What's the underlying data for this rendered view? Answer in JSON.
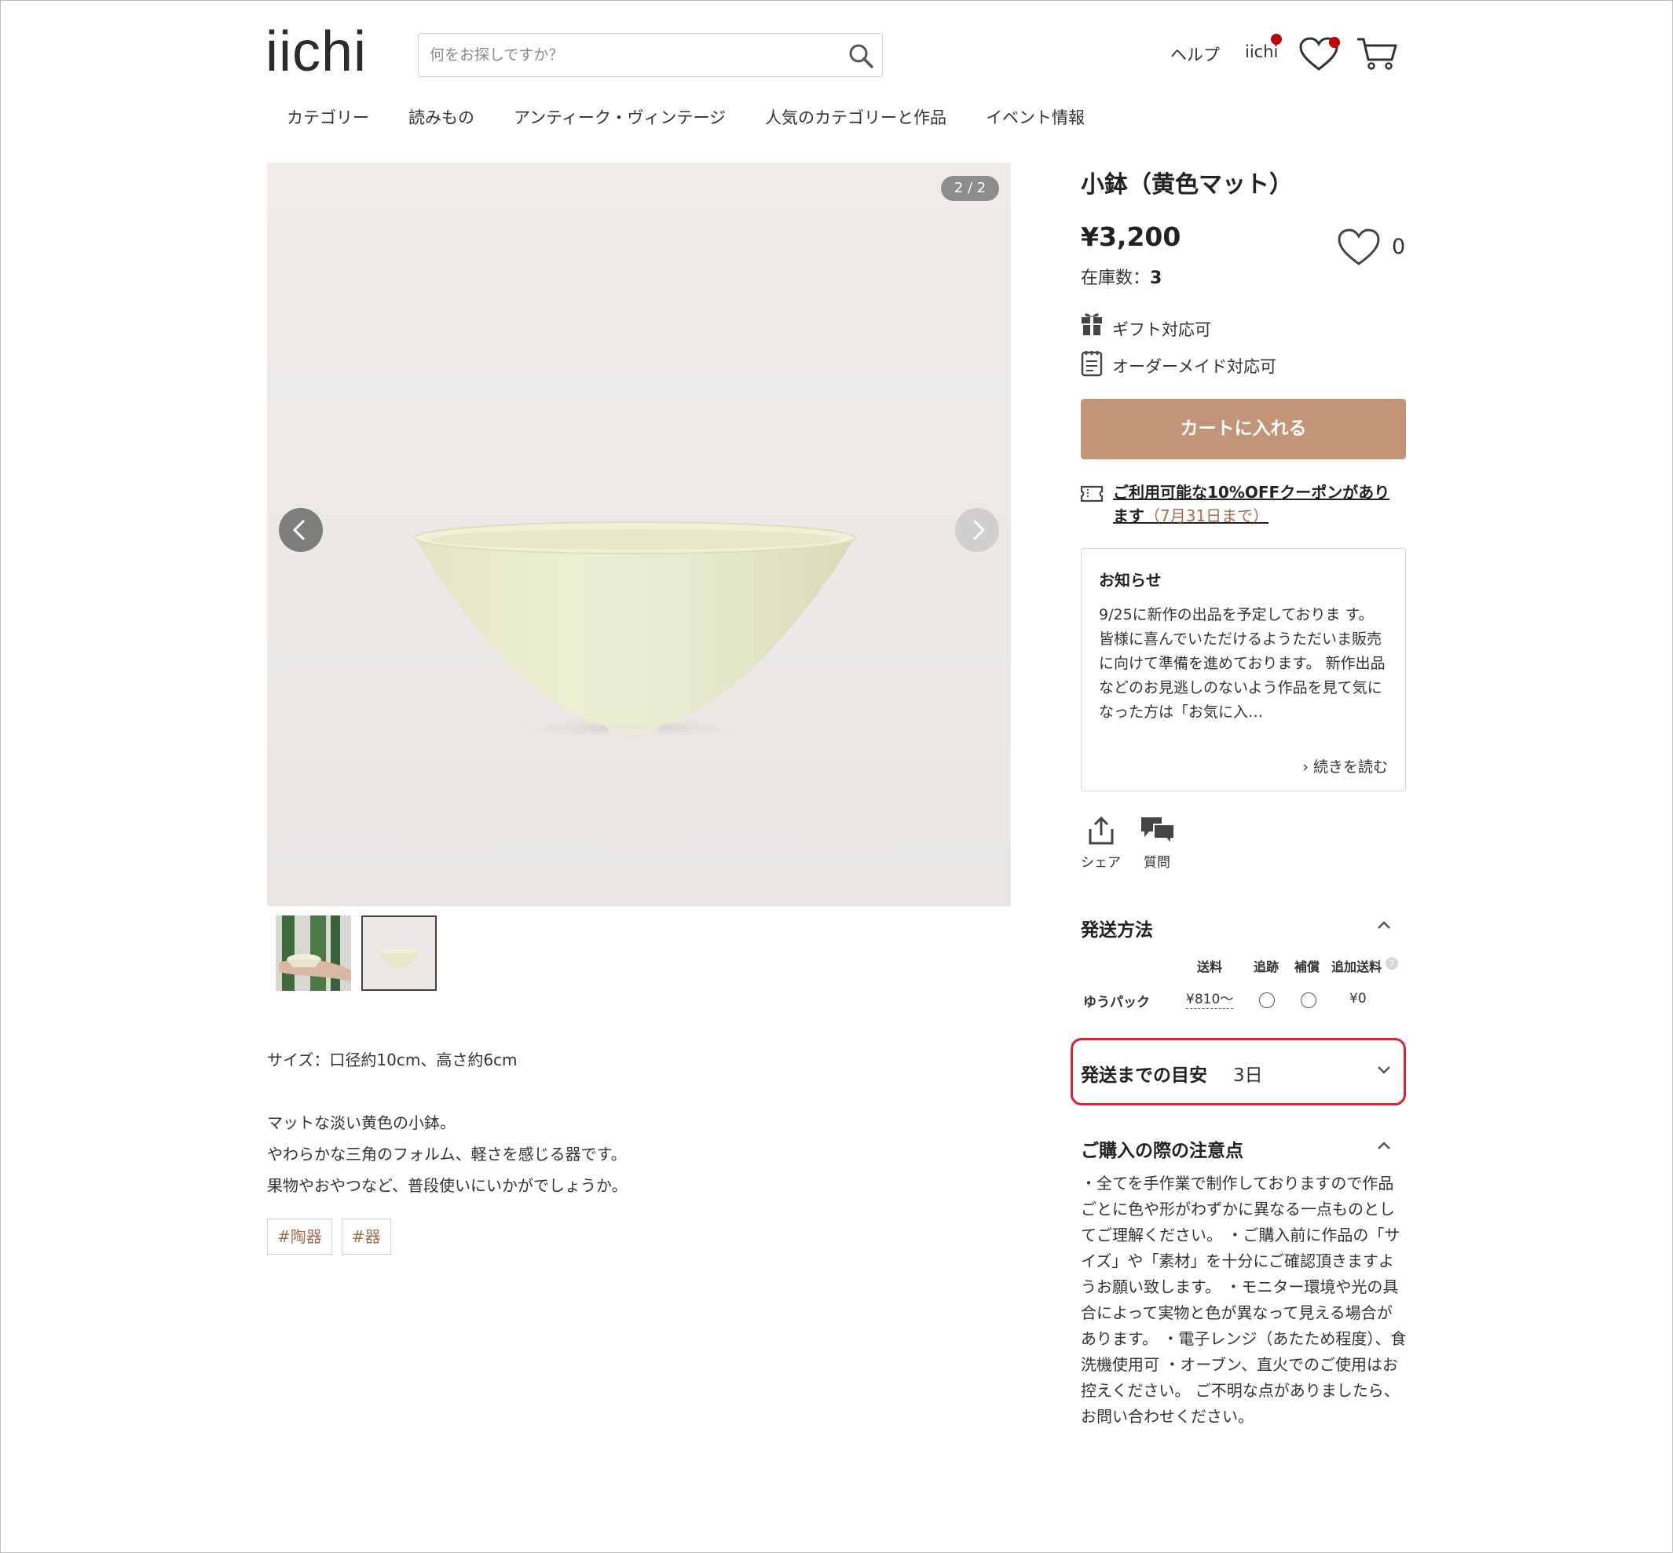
{
  "header": {
    "logo": "iichi",
    "search_placeholder": "何をお探しですか？",
    "help": "ヘルプ",
    "user": "iichi"
  },
  "category_nav": [
    "カテゴリー",
    "読みもの",
    "アンティーク・ヴィンテージ",
    "人気のカテゴリーと作品",
    "イベント情報"
  ],
  "gallery": {
    "counter": "2 / 2",
    "thumbnails": [
      "thumbnail-hand-bowl",
      "thumbnail-yellow-bowl"
    ],
    "selected_index": 2
  },
  "description": {
    "size": "サイズ：口径約10cm、高さ約6cm",
    "lines": [
      "マットな淡い黄色の小鉢。",
      "やわらかな三角のフォルム、軽さを感じる器です。",
      "果物やおやつなど、普段使いにいかがでしょうか。"
    ]
  },
  "tags": [
    "#陶器",
    "#器"
  ],
  "product": {
    "title": "小鉢（黄色マット）",
    "price": "¥3,200",
    "stock_label": "在庫数：",
    "stock_value": "3",
    "favorites": "0",
    "gift": "ギフト対応可",
    "order_made": "オーダーメイド対応可",
    "cart_button": "カートに入れる",
    "coupon_line1": "ご利用可能な10%OFFクーポンがあり",
    "coupon_line2": "ます",
    "coupon_deadline": "（7月31日まで）"
  },
  "notice": {
    "heading": "お知らせ",
    "body": "9/25に新作の出品を予定しておりま す。 皆様に喜んでいただけるようただいま販売に向けて準備を進めております。 新作出品などのお見逃しのないよう作品を見て気になった方は「お気に入…",
    "more": "› 続きを読む"
  },
  "actions": {
    "share": "シェア",
    "question": "質問"
  },
  "shipping": {
    "heading": "発送方法",
    "columns": [
      "送料",
      "追跡",
      "補償",
      "追加送料"
    ],
    "row": {
      "method": "ゆうパック",
      "fee": "¥810〜",
      "extra": "¥0"
    }
  },
  "eta": {
    "label": "発送までの目安",
    "value": "3日"
  },
  "purchase_notes": {
    "heading": "ご購入の際の注意点",
    "text": "・全てを手作業で制作しておりますので作品ごとに色や形がわずかに異なる一点ものとしてご理解ください。 ・ご購入前に作品の「サイズ」や「素材」を十分にご確認頂きますようお願い致します。 ・モニター環境や光の具合によって実物と色が異なって見える場合があります。 ・電子レンジ（あたため程度）、食洗機使用可 ・オーブン、直火でのご使用はお控えください。 ご不明な点がありましたら、お問い合わせください。"
  },
  "colors": {
    "accent": "#c29478",
    "tag_text": "#a46c4f",
    "highlight": "#e0202e",
    "badge": "#c00000"
  }
}
